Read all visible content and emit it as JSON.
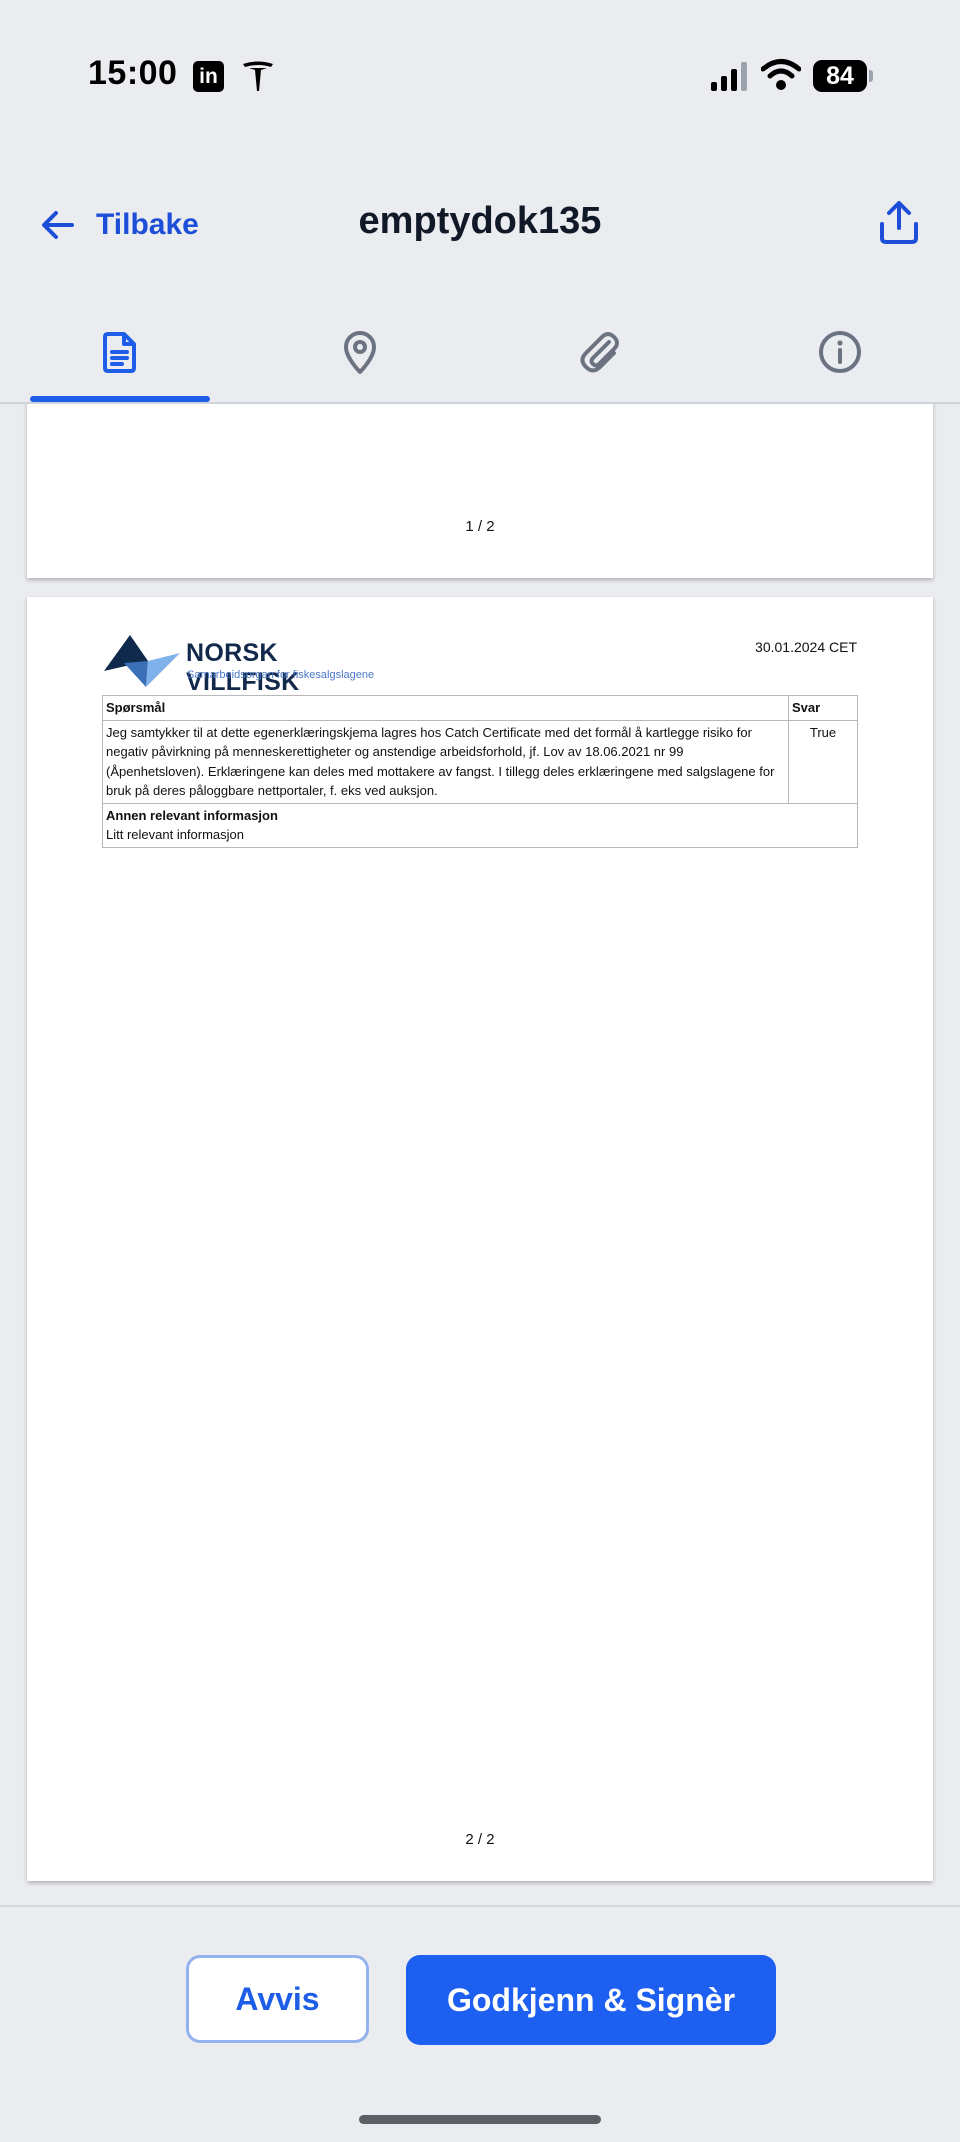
{
  "status_bar": {
    "time": "15:00",
    "linkedin_glyph": "in",
    "battery_level": "84",
    "icons": [
      "linkedin-icon",
      "tesla-icon",
      "signal-icon",
      "wifi-icon",
      "battery-icon"
    ]
  },
  "header": {
    "back_label": "Tilbake",
    "title": "emptydok135",
    "share_icon": "share-icon"
  },
  "tabs": [
    {
      "name": "document",
      "icon": "document-icon",
      "active": true
    },
    {
      "name": "location",
      "icon": "location-pin-icon",
      "active": false
    },
    {
      "name": "attachments",
      "icon": "paperclip-icon",
      "active": false
    },
    {
      "name": "info",
      "icon": "info-icon",
      "active": false
    }
  ],
  "document": {
    "page1": {
      "page_number": "1 / 2"
    },
    "page2": {
      "logo_name": "NORSK VILLFISK",
      "logo_tagline": "Samarbeidsorgan for fiskesalgslagene",
      "date": "30.01.2024 CET",
      "table": {
        "header_question": "Spørsmål",
        "header_answer": "Svar",
        "question_text": "Jeg samtykker til at dette egenerklæringskjema lagres hos Catch Certificate med det formål å kartlegge risiko for negativ påvirkning på menneskerettigheter og anstendige arbeidsforhold, jf. Lov av 18.06.2021 nr 99 (Åpenhetsloven). Erklæringene kan deles med mottakere av fangst. I tillegg deles erklæringene med salgslagene for bruk på deres påloggbare nettportaler, f. eks ved auksjon.",
        "answer_value": "True",
        "other_info_heading": "Annen relevant informasjon",
        "other_info_value": "Litt relevant informasjon"
      },
      "page_number": "2 / 2"
    }
  },
  "actions": {
    "reject_label": "Avvis",
    "approve_label": "Godkjenn & Signèr"
  },
  "colors": {
    "accent": "#1d5ff0",
    "link": "#1d4ed8",
    "background": "#eaecf0",
    "icon_inactive": "#6b7280"
  }
}
